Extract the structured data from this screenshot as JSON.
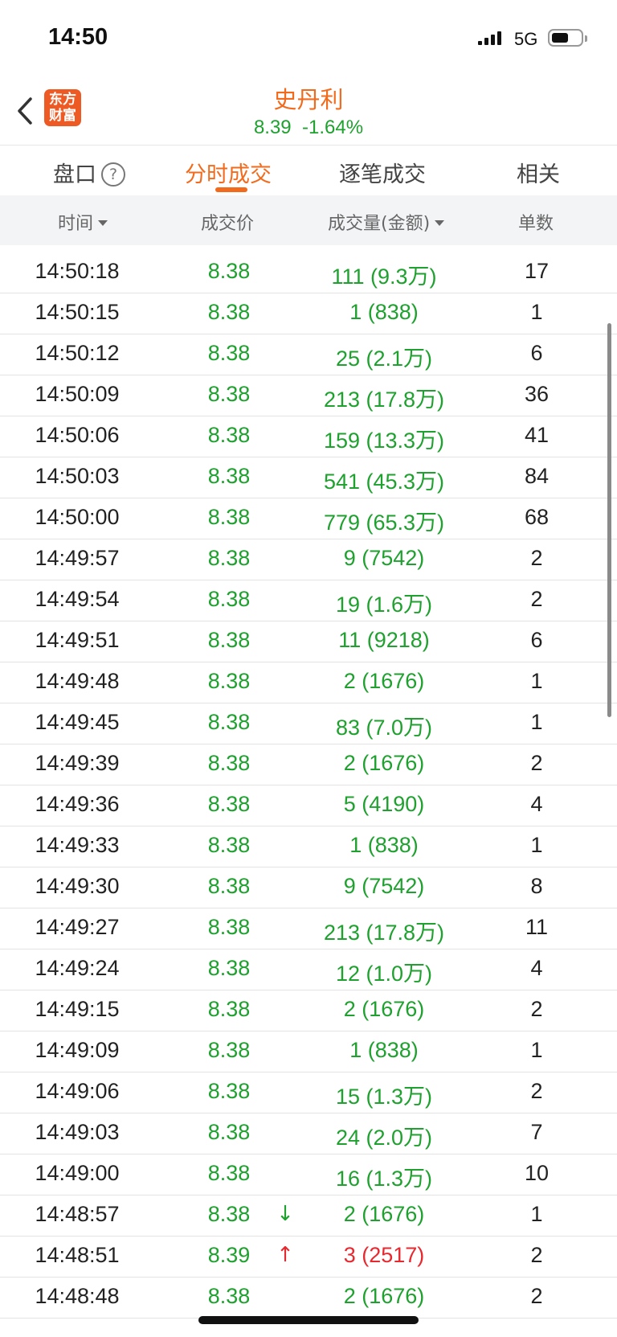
{
  "status_bar": {
    "time": "14:50",
    "network": "5G",
    "battery_level": 0.55
  },
  "header": {
    "logo_text_line1": "东方",
    "logo_text_line2": "财富",
    "title": "史丹利",
    "price": "8.39",
    "change": "-1.64%"
  },
  "tabs": [
    {
      "label": "盘口",
      "active": false
    },
    {
      "label": "分时成交",
      "active": true
    },
    {
      "label": "逐笔成交",
      "active": false
    },
    {
      "label": "相关",
      "active": false
    }
  ],
  "help_icon_text": "?",
  "columns": {
    "time": "时间",
    "price": "成交价",
    "volume": "成交量(金额)",
    "count": "单数"
  },
  "colors": {
    "down": "#1fa12f",
    "up": "#e8282f",
    "accent": "#f26b1d"
  },
  "rows": [
    {
      "time": "14:50:18",
      "price": "8.38",
      "arrow": "",
      "volume": "111 (9.3万)",
      "count": "17",
      "color": "down"
    },
    {
      "time": "14:50:15",
      "price": "8.38",
      "arrow": "",
      "volume": "1 (838)",
      "count": "1",
      "color": "down"
    },
    {
      "time": "14:50:12",
      "price": "8.38",
      "arrow": "",
      "volume": "25 (2.1万)",
      "count": "6",
      "color": "down"
    },
    {
      "time": "14:50:09",
      "price": "8.38",
      "arrow": "",
      "volume": "213 (17.8万)",
      "count": "36",
      "color": "down"
    },
    {
      "time": "14:50:06",
      "price": "8.38",
      "arrow": "",
      "volume": "159 (13.3万)",
      "count": "41",
      "color": "down"
    },
    {
      "time": "14:50:03",
      "price": "8.38",
      "arrow": "",
      "volume": "541 (45.3万)",
      "count": "84",
      "color": "down"
    },
    {
      "time": "14:50:00",
      "price": "8.38",
      "arrow": "",
      "volume": "779 (65.3万)",
      "count": "68",
      "color": "down"
    },
    {
      "time": "14:49:57",
      "price": "8.38",
      "arrow": "",
      "volume": "9 (7542)",
      "count": "2",
      "color": "down"
    },
    {
      "time": "14:49:54",
      "price": "8.38",
      "arrow": "",
      "volume": "19 (1.6万)",
      "count": "2",
      "color": "down"
    },
    {
      "time": "14:49:51",
      "price": "8.38",
      "arrow": "",
      "volume": "11 (9218)",
      "count": "6",
      "color": "down"
    },
    {
      "time": "14:49:48",
      "price": "8.38",
      "arrow": "",
      "volume": "2 (1676)",
      "count": "1",
      "color": "down"
    },
    {
      "time": "14:49:45",
      "price": "8.38",
      "arrow": "",
      "volume": "83 (7.0万)",
      "count": "1",
      "color": "down"
    },
    {
      "time": "14:49:39",
      "price": "8.38",
      "arrow": "",
      "volume": "2 (1676)",
      "count": "2",
      "color": "down"
    },
    {
      "time": "14:49:36",
      "price": "8.38",
      "arrow": "",
      "volume": "5 (4190)",
      "count": "4",
      "color": "down"
    },
    {
      "time": "14:49:33",
      "price": "8.38",
      "arrow": "",
      "volume": "1 (838)",
      "count": "1",
      "color": "down"
    },
    {
      "time": "14:49:30",
      "price": "8.38",
      "arrow": "",
      "volume": "9 (7542)",
      "count": "8",
      "color": "down"
    },
    {
      "time": "14:49:27",
      "price": "8.38",
      "arrow": "",
      "volume": "213 (17.8万)",
      "count": "11",
      "color": "down"
    },
    {
      "time": "14:49:24",
      "price": "8.38",
      "arrow": "",
      "volume": "12 (1.0万)",
      "count": "4",
      "color": "down"
    },
    {
      "time": "14:49:15",
      "price": "8.38",
      "arrow": "",
      "volume": "2 (1676)",
      "count": "2",
      "color": "down"
    },
    {
      "time": "14:49:09",
      "price": "8.38",
      "arrow": "",
      "volume": "1 (838)",
      "count": "1",
      "color": "down"
    },
    {
      "time": "14:49:06",
      "price": "8.38",
      "arrow": "",
      "volume": "15 (1.3万)",
      "count": "2",
      "color": "down"
    },
    {
      "time": "14:49:03",
      "price": "8.38",
      "arrow": "",
      "volume": "24 (2.0万)",
      "count": "7",
      "color": "down"
    },
    {
      "time": "14:49:00",
      "price": "8.38",
      "arrow": "",
      "volume": "16 (1.3万)",
      "count": "10",
      "color": "down"
    },
    {
      "time": "14:48:57",
      "price": "8.38",
      "arrow": "↓",
      "volume": "2 (1676)",
      "count": "1",
      "color": "down"
    },
    {
      "time": "14:48:51",
      "price": "8.39",
      "arrow": "↑",
      "volume": "3 (2517)",
      "count": "2",
      "color": "up",
      "price_color": "down"
    },
    {
      "time": "14:48:48",
      "price": "8.38",
      "arrow": "",
      "volume": "2 (1676)",
      "count": "2",
      "color": "down"
    }
  ]
}
